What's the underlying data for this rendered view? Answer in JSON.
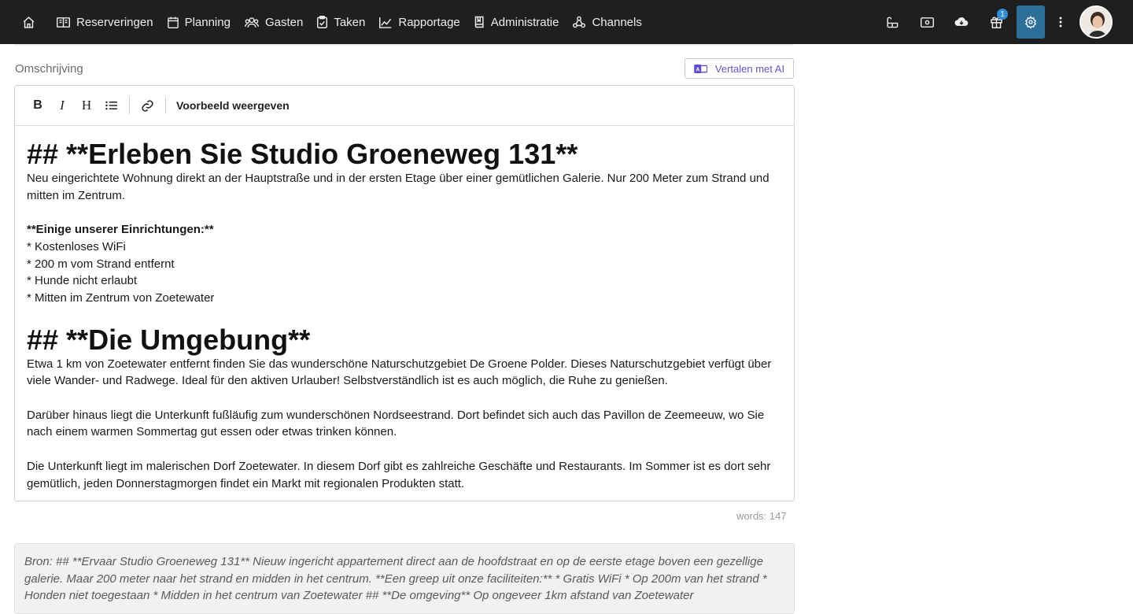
{
  "nav": {
    "items": [
      {
        "label": "Reserveringen",
        "icon": "map-book-icon"
      },
      {
        "label": "Planning",
        "icon": "calendar-icon"
      },
      {
        "label": "Gasten",
        "icon": "users-icon"
      },
      {
        "label": "Taken",
        "icon": "clipboard-icon"
      },
      {
        "label": "Rapportage",
        "icon": "chart-line-icon"
      },
      {
        "label": "Administratie",
        "icon": "book-icon"
      },
      {
        "label": "Channels",
        "icon": "share-icon"
      }
    ],
    "gift_badge": "1"
  },
  "field": {
    "label": "Omschrijving",
    "translate_button": "Vertalen met AI"
  },
  "toolbar": {
    "preview_label": "Voorbeeld weergeven"
  },
  "content": {
    "heading1": "## **Erleben Sie Studio Groeneweg 131**",
    "para1": "Neu eingerichtete Wohnung direkt an der Hauptstraße und in der ersten Etage über einer gemütlichen Galerie. Nur 200 Meter zum Strand und mitten im Zentrum.",
    "facilities_title": "**Einige unserer Einrichtungen:**",
    "facilities": [
      "* Kostenloses WiFi",
      "* 200 m vom Strand entfernt",
      "* Hunde nicht erlaubt",
      "* Mitten im Zentrum von Zoetewater"
    ],
    "heading2": "## **Die Umgebung**",
    "para2": "Etwa 1 km von Zoetewater entfernt finden Sie das wunderschöne Naturschutzgebiet De Groene Polder. Dieses Naturschutzgebiet verfügt über viele Wander- und Radwege. Ideal für den aktiven Urlauber! Selbstverständlich ist es auch möglich, die Ruhe zu genießen.",
    "para3": "Darüber hinaus liegt die Unterkunft fußläufig zum wunderschönen Nordseestrand. Dort befindet sich auch das Pavillon de Zeemeeuw, wo Sie nach einem warmen Sommertag gut essen oder etwas trinken können.",
    "para4": "Die Unterkunft liegt im malerischen Dorf Zoetewater. In diesem Dorf gibt es zahlreiche Geschäfte und Restaurants. Im Sommer ist es dort sehr gemütlich, jeden Donnerstagmorgen findet ein Markt mit regionalen Produkten statt."
  },
  "word_count": "words: 147",
  "source_text": "Bron: ## **Ervaar Studio Groeneweg 131** Nieuw ingericht appartement direct aan de hoofdstraat en op de eerste etage boven een gezellige galerie. Maar 200 meter naar het strand en midden in het centrum. **Een greep uit onze faciliteiten:** * Gratis WiFi * Op 200m van het strand * Honden niet toegestaan * Midden in het centrum van Zoetewater ## **De omgeving** Op ongeveer 1km afstand van Zoetewater"
}
